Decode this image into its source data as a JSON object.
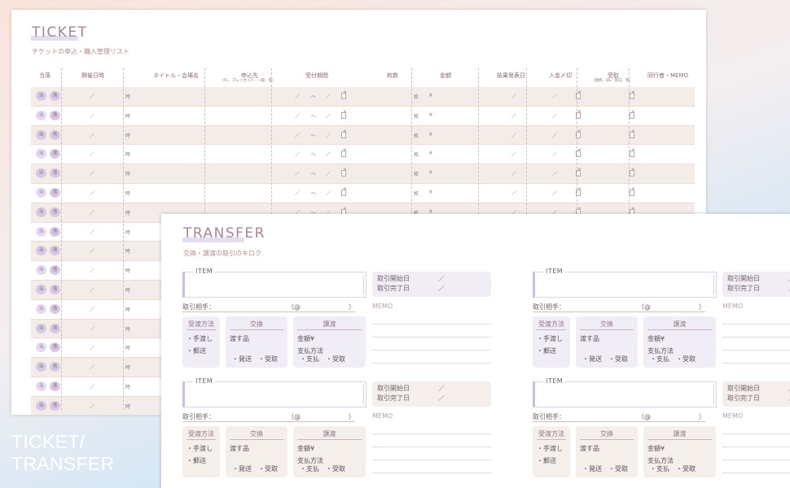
{
  "ticket": {
    "title": "TICKET",
    "subtitle": "チケットの申込・購入管理リスト",
    "columns": {
      "result": "当落",
      "date": "開催日時",
      "title_venue": "タイトル・会場名",
      "apply_to": "申込先",
      "apply_to_note": "（FC、プレイガイド、一般、等）",
      "period": "受付期間",
      "count": "枚数",
      "price": "金額",
      "announce": "結果発表日",
      "payment": "入金〆切",
      "receive": "受取",
      "receive_note": "（発券、DL、窓口、等）",
      "companion": "同行者・MEMO"
    },
    "row_marks": {
      "win": "当",
      "lose": "落",
      "slash": "／",
      "time": "時",
      "tilde": "〜",
      "deadline": "〆",
      "count_unit": "枚",
      "yen": "¥"
    },
    "row_count": 17
  },
  "transfer": {
    "title": "TRANSFER",
    "subtitle": "交換・譲渡の取引のキロク",
    "item_label": "ITEM",
    "start_label": "取引開始日",
    "end_label": "取引完了日",
    "slash": "／",
    "partner_label": "取引相手：",
    "partner_at": "（@",
    "partner_close": "）",
    "memo_label": "MEMO",
    "method": {
      "title": "受渡方法",
      "opt1": "・手渡し",
      "opt2": "・郵送"
    },
    "exchange": {
      "title": "交換",
      "line1": "渡す品",
      "opt1": "・発送",
      "opt2": "・受取"
    },
    "give": {
      "title": "譲渡",
      "line1": "金額¥",
      "line2": "支払方法",
      "opt1": "・支払",
      "opt2": "・受取"
    }
  },
  "caption": {
    "line1": "TICKET/",
    "line2": "TRANSFER"
  },
  "colors": {
    "purple_fill": "#f1edf7",
    "beige_fill": "#f4efeb",
    "title": "#a2879a"
  }
}
